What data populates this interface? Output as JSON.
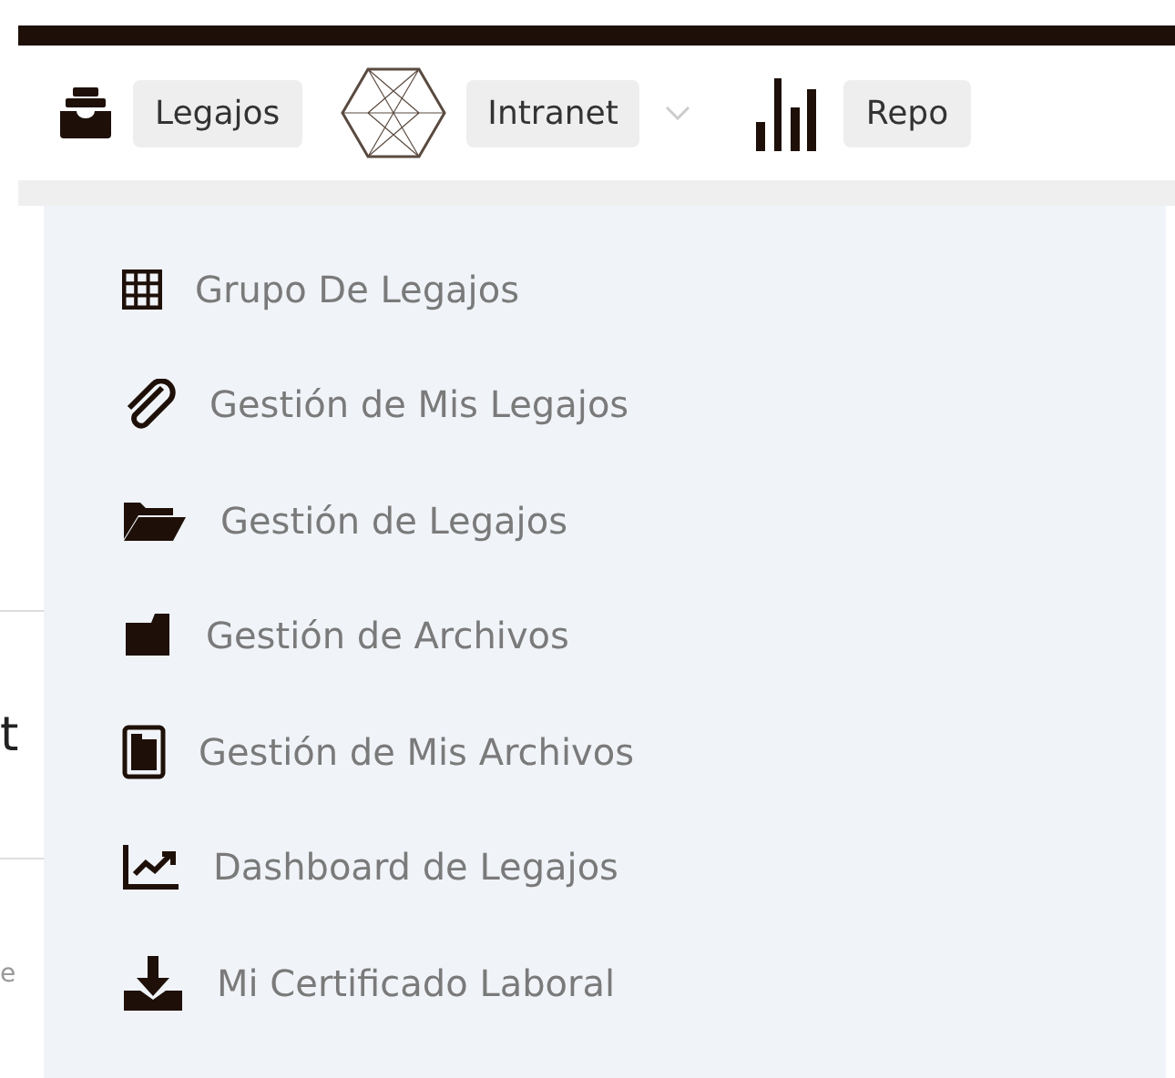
{
  "nav": [
    {
      "kind": "archive",
      "label": "Legajos",
      "dropdown": false
    },
    {
      "kind": "hexagon",
      "label": "Intranet",
      "dropdown": true
    },
    {
      "kind": "bars",
      "label": "Repo",
      "dropdown": false
    }
  ],
  "background_fragments": [
    "t",
    "e"
  ],
  "menu": {
    "items": [
      {
        "kind": "grid",
        "label": "Grupo De Legajos"
      },
      {
        "kind": "paperclip",
        "label": "Gestión de Mis Legajos"
      },
      {
        "kind": "folder-open",
        "label": "Gestión de Legajos"
      },
      {
        "kind": "folder",
        "label": "Gestión de Archivos"
      },
      {
        "kind": "file",
        "label": "Gestión de Mis Archivos"
      },
      {
        "kind": "chart",
        "label": "Dashboard de Legajos"
      },
      {
        "kind": "download",
        "label": "Mi Certificado Laboral"
      }
    ]
  }
}
